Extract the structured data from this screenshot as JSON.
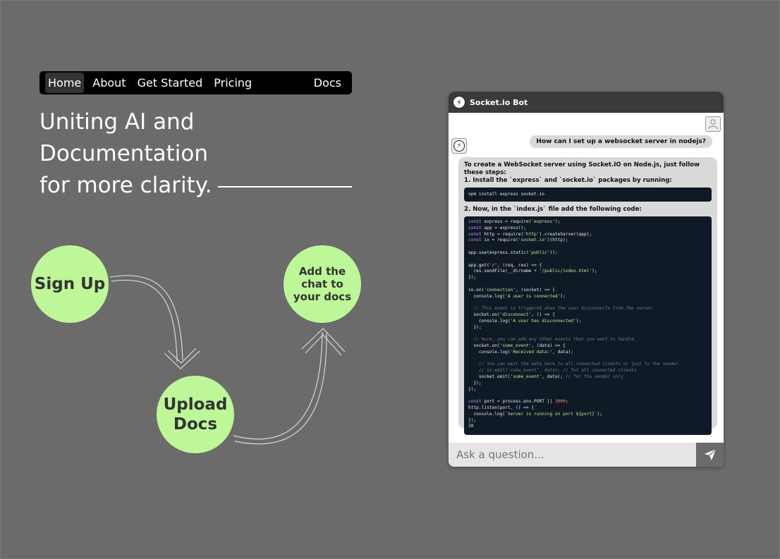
{
  "nav": {
    "items": [
      "Home",
      "About",
      "Get Started",
      "Pricing"
    ],
    "docs": "Docs"
  },
  "headline": {
    "line1": "Uniting AI and Documentation",
    "line2": "for more clarity."
  },
  "steps": {
    "sign_up": "Sign Up",
    "upload_line1": "Upload",
    "upload_line2": "Docs",
    "add_chat": "Add the chat to your docs"
  },
  "chat": {
    "title": "Socket.io Bot",
    "user_message": "How can I set up a websocket server in nodejs?",
    "bot_intro": "To create a WebSocket server using Socket.IO on Node.js, just follow these steps:",
    "step1": "1. Install the `express` and `socket.io` packages by running:",
    "command": "npm install express socket.io",
    "step2": "2. Now, in the `index.js` file add the following code:",
    "input_placeholder": "Ask a question..."
  },
  "colors": {
    "background": "#6b6b6b",
    "circle": "#bef798",
    "code_bg": "#101a26"
  },
  "icons": {
    "bot": "socketio-logo-icon",
    "user": "user-avatar-icon",
    "send": "paper-plane-icon"
  }
}
